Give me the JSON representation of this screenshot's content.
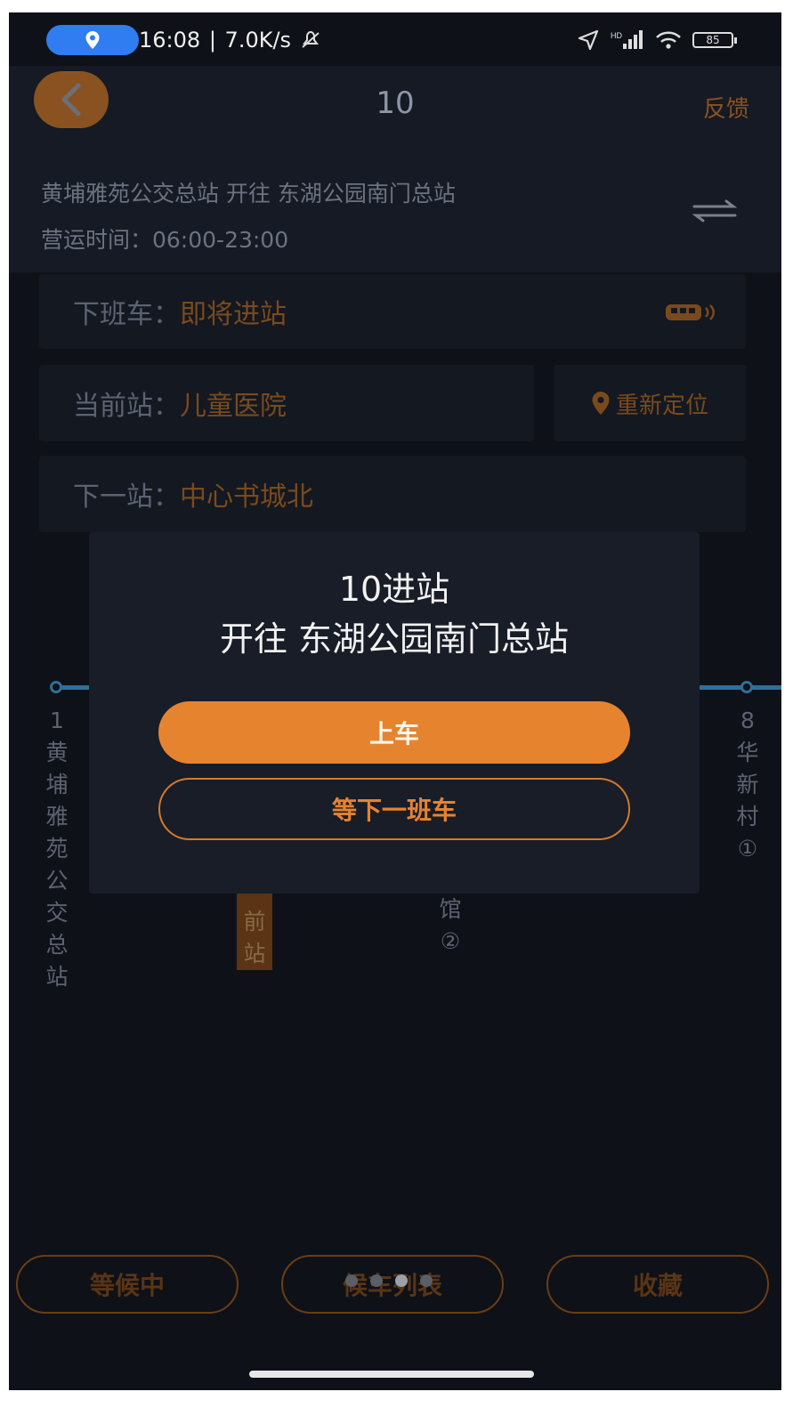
{
  "status_bar": {
    "time": "16:08",
    "separator": "|",
    "speed": "7.0K/s",
    "battery": "85"
  },
  "header": {
    "back_icon": "chevron-left-icon",
    "route_number": "10",
    "feedback_label": "反馈",
    "direction": "黄埔雅苑公交总站 开往 东湖公园南门总站",
    "operating_hours": "营运时间：06:00-23:00"
  },
  "info": {
    "next_bus_label": "下班车：",
    "next_bus_value": "即将进站",
    "current_stop_label": "当前站：",
    "current_stop_value": "儿童医院",
    "relocate_label": "重新定位",
    "next_stop_label": "下一站：",
    "next_stop_value": "中心书城北"
  },
  "route_stops": {
    "first_index": "1",
    "first_name": "黄\n埔\n雅\n苑\n公\n交\n总\n站",
    "current_partial": "前\n站",
    "middle_partial": "馆\n②",
    "last_index": "8",
    "last_name": "华\n新\n村\n①"
  },
  "modal": {
    "title": "10进站",
    "subtitle": "开往 东湖公园南门总站",
    "board_label": "上车",
    "wait_label": "等下一班车"
  },
  "bottom": {
    "waiting_label": "等候中",
    "list_label": "候车列表",
    "favorite_label": "收藏"
  },
  "colors": {
    "accent": "#e6832f",
    "background": "#0e1117",
    "route_line": "#2f6f96"
  }
}
